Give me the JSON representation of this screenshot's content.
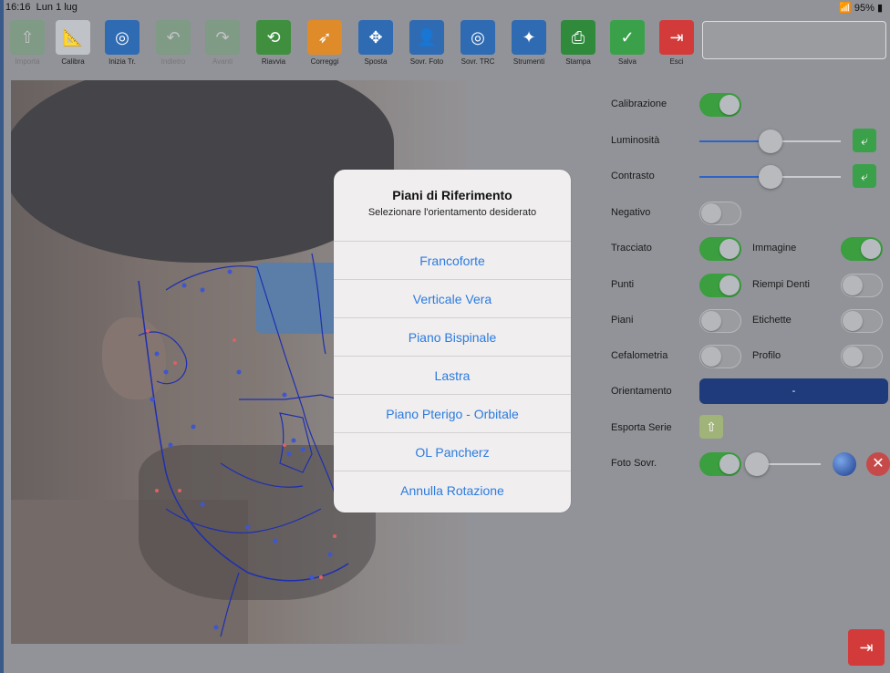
{
  "status_bar": {
    "time": "16:16",
    "date": "Lun 1 lug",
    "battery": "95%"
  },
  "toolbar": [
    {
      "id": "importa",
      "label": "Importa",
      "enabled": false,
      "color": "#6aa36f",
      "glyph": "⇧"
    },
    {
      "id": "calibra",
      "label": "Calibra",
      "enabled": true,
      "color": "#bfc3c7",
      "glyph": "📐"
    },
    {
      "id": "inizia",
      "label": "Inizia Tr.",
      "enabled": true,
      "color": "#2f6bb3",
      "glyph": "◎"
    },
    {
      "id": "indietro",
      "label": "Indietro",
      "enabled": false,
      "color": "#6aa36f",
      "glyph": "↶"
    },
    {
      "id": "avanti",
      "label": "Avanti",
      "enabled": false,
      "color": "#6aa36f",
      "glyph": "↷"
    },
    {
      "id": "riavvia",
      "label": "Riavvia",
      "enabled": true,
      "color": "#3f8f3f",
      "glyph": "⟲"
    },
    {
      "id": "correggi",
      "label": "Correggi",
      "enabled": true,
      "color": "#e08b2a",
      "glyph": "➶"
    },
    {
      "id": "sposta",
      "label": "Sposta",
      "enabled": true,
      "color": "#2f6bb3",
      "glyph": "✥"
    },
    {
      "id": "sovr_foto",
      "label": "Sovr. Foto",
      "enabled": true,
      "color": "#2f6bb3",
      "glyph": "👤"
    },
    {
      "id": "sovr_trc",
      "label": "Sovr. TRC",
      "enabled": true,
      "color": "#2f6bb3",
      "glyph": "◎"
    },
    {
      "id": "strumenti",
      "label": "Strumenti",
      "enabled": true,
      "color": "#2f6bb3",
      "glyph": "✦"
    },
    {
      "id": "stampa",
      "label": "Stampa",
      "enabled": true,
      "color": "#2f8a3c",
      "glyph": "⎙"
    },
    {
      "id": "salva",
      "label": "Salva",
      "enabled": true,
      "color": "#3aa14a",
      "glyph": "✓"
    },
    {
      "id": "esci",
      "label": "Esci",
      "enabled": true,
      "color": "#d33b3b",
      "glyph": "⇥"
    }
  ],
  "dialog": {
    "title": "Piani di Riferimento",
    "subtitle": "Selezionare l'orientamento desiderato",
    "options": [
      "Francoforte",
      "Verticale Vera",
      "Piano Bispinale",
      "Lastra",
      "Piano Pterigo - Orbitale",
      "OL Pancherz",
      "Annulla Rotazione"
    ]
  },
  "panel": {
    "calibrazione": {
      "label": "Calibrazione",
      "on": true
    },
    "luminosita": {
      "label": "Luminosità",
      "value": 0.5
    },
    "contrasto": {
      "label": "Contrasto",
      "value": 0.5
    },
    "negativo": {
      "label": "Negativo",
      "on": false
    },
    "tracciato": {
      "label": "Tracciato",
      "on": true
    },
    "immagine": {
      "label": "Immagine",
      "on": true
    },
    "punti": {
      "label": "Punti",
      "on": true
    },
    "riempi_denti": {
      "label": "Riempi Denti",
      "on": false
    },
    "piani": {
      "label": "Piani",
      "on": false
    },
    "etichette": {
      "label": "Etichette",
      "on": false
    },
    "cefalometria": {
      "label": "Cefalometria",
      "on": false
    },
    "profilo": {
      "label": "Profilo",
      "on": false
    },
    "orientamento": {
      "label": "Orientamento",
      "value": "-"
    },
    "esporta_serie": {
      "label": "Esporta Serie"
    },
    "foto_sovr": {
      "label": "Foto Sovr.",
      "on": true,
      "value": 0.0
    }
  }
}
